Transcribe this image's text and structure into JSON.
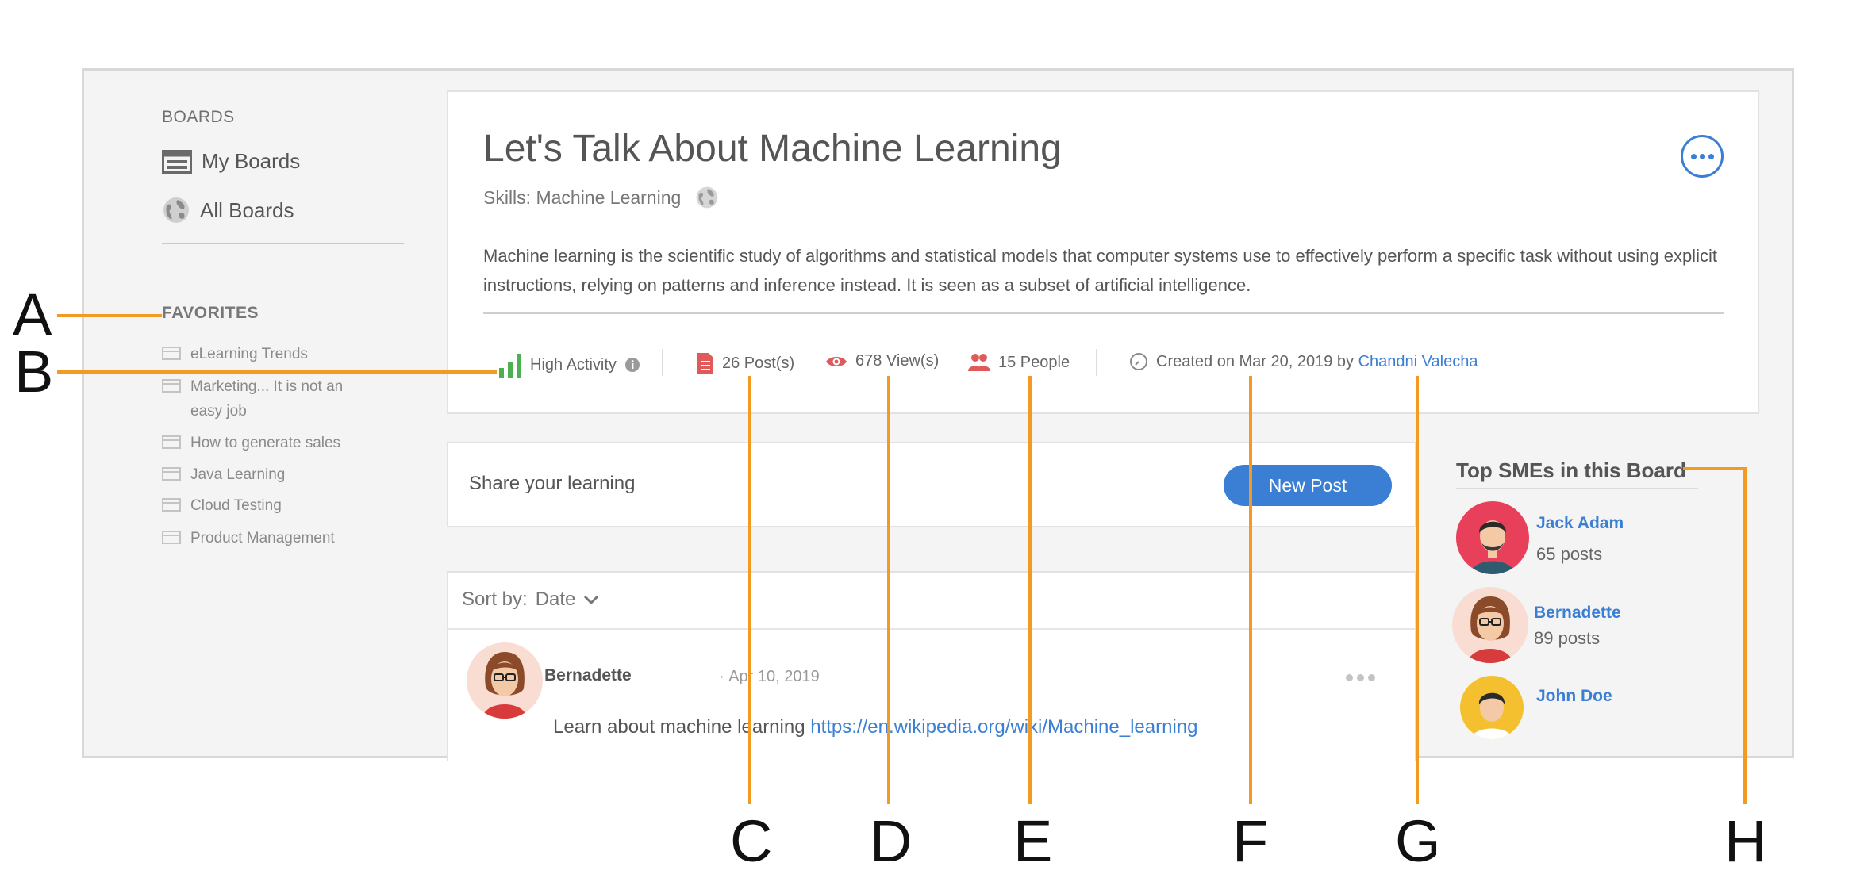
{
  "sidebar": {
    "boards_heading": "BOARDS",
    "my_boards": "My Boards",
    "all_boards": "All Boards",
    "favorites_heading": "FAVORITES",
    "favorites": [
      "eLearning Trends",
      "Marketing... It is not an easy job",
      "How to generate sales",
      "Java Learning",
      "Cloud Testing",
      "Product Management"
    ]
  },
  "board": {
    "title": "Let's Talk About Machine Learning",
    "skills": "Skills: Machine Learning",
    "description": "Machine learning is the scientific study of algorithms and statistical models that computer systems use to effectively perform a specific task without using explicit instructions, relying on patterns and inference instead. It is seen as a subset of artificial intelligence.",
    "activity": "High Activity",
    "posts": "26 Post(s)",
    "views": "678 View(s)",
    "people": "15 People",
    "created": "Created on Mar 20, 2019 by",
    "creator": "Chandni Valecha"
  },
  "share": {
    "placeholder": "Share your learning",
    "button": "New Post"
  },
  "feed": {
    "sort_label": "Sort by:",
    "sort_value": "Date",
    "post": {
      "author": "Bernadette",
      "date": "Apr 10, 2019",
      "text": "Learn about machine learning",
      "link": "https://en.wikipedia.org/wiki/Machine_learning"
    }
  },
  "smes": {
    "heading": "Top SMEs in this Board",
    "items": [
      {
        "name": "Jack Adam",
        "posts": "65 posts"
      },
      {
        "name": "Bernadette",
        "posts": "89 posts"
      },
      {
        "name": "John Doe",
        "posts": ""
      }
    ]
  },
  "annotations": {
    "A": "A",
    "B": "B",
    "C": "C",
    "D": "D",
    "E": "E",
    "F": "F",
    "G": "G",
    "H": "H"
  },
  "colors": {
    "accent": "#3b7fd4",
    "annotation": "#f39a22",
    "activity": "#4caf50",
    "stat_icons": "#e05a5a"
  }
}
